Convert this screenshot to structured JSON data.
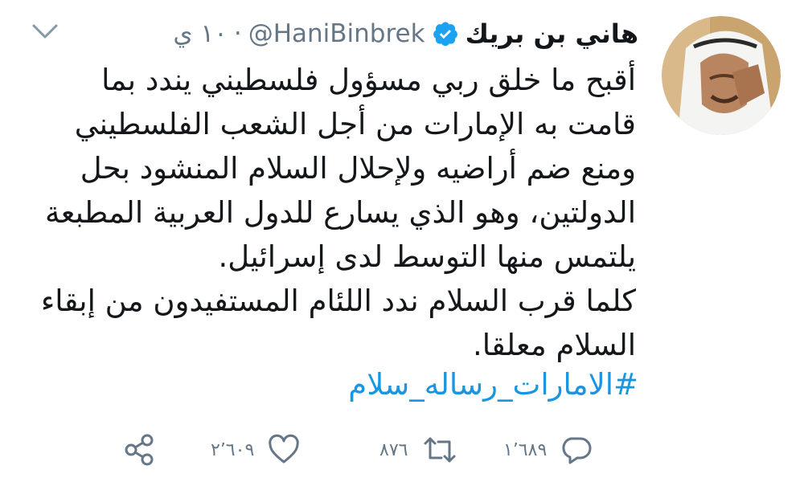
{
  "tweet": {
    "display_name": "هاني بن بريك",
    "handle": "@HaniBinbrek",
    "separator": "·",
    "time": "١٠ ي",
    "text_paragraphs": [
      "أقبح ما خلق ربي مسؤول فلسطيني يندد بما قامت به الإمارات من أجل الشعب الفلسطيني ومنع ضم أراضيه ولإحلال السلام المنشود بحل الدولتين، وهو الذي يسارع للدول العربية المطبعة يلتمس منها التوسط لدى إسرائيل.",
      "كلما قرب السلام ندد اللئام المستفيدون من إبقاء السلام معلقا."
    ],
    "hashtag": "#الامارات_رساله_سلام"
  },
  "actions": {
    "reply_count": "١٬٦٨٩",
    "retweet_count": "٨٧٦",
    "like_count": "٢٬٦٠٩"
  },
  "icons": {
    "avatar": "avatar",
    "verified": "verified-badge-icon",
    "menu": "chevron-down-icon",
    "reply": "reply-icon",
    "retweet": "retweet-icon",
    "like": "heart-icon",
    "share": "share-icon"
  },
  "colors": {
    "text": "#14171a",
    "secondary": "#657786",
    "accent": "#1b95e0",
    "background": "#ffffff"
  }
}
